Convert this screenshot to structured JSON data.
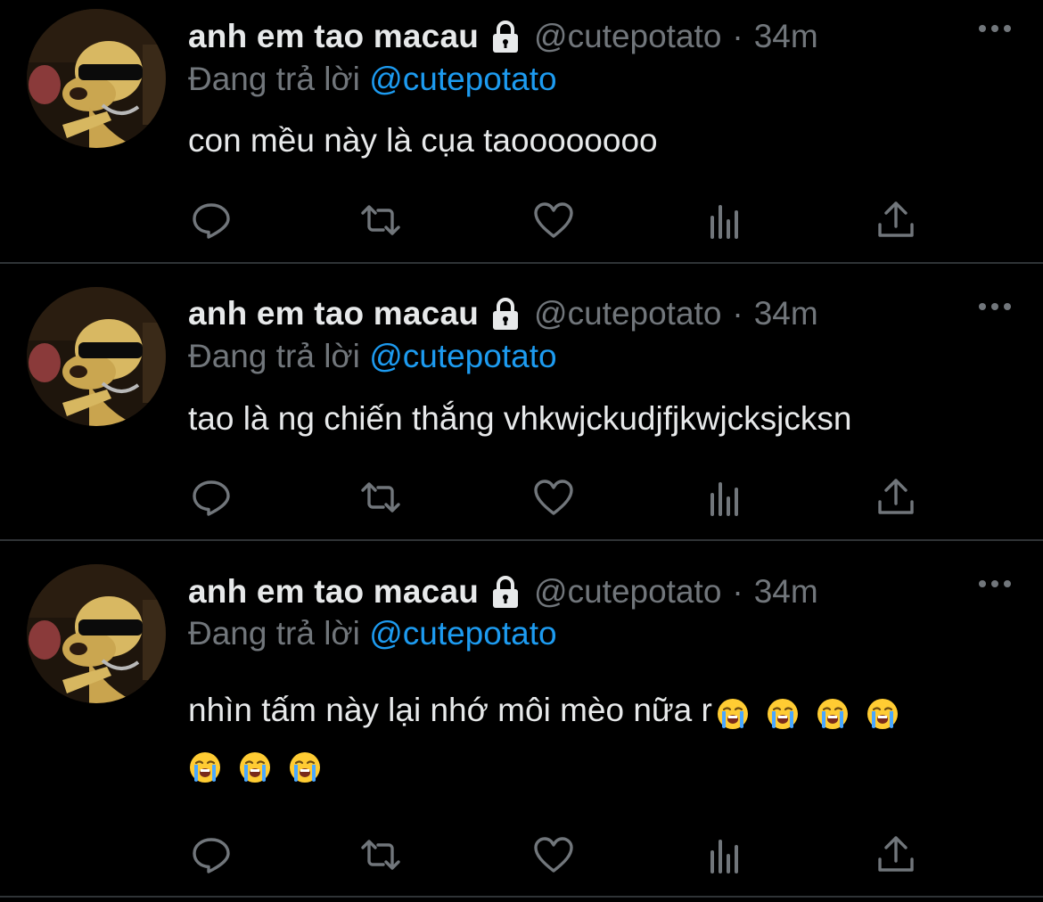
{
  "tweets": [
    {
      "name": "anh em tao macau",
      "handle": "@cutepotato",
      "dot": "·",
      "time": "34m",
      "replying_prefix": "Đang trả lời",
      "replying_to": "@cutepotato",
      "text": "con mều này là cụa taoooooooo",
      "emojis": []
    },
    {
      "name": "anh em tao macau",
      "handle": "@cutepotato",
      "dot": "·",
      "time": "34m",
      "replying_prefix": "Đang trả lời",
      "replying_to": "@cutepotato",
      "text": "tao là ng chiến thắng vhkwjckudjfjkwjcksjcksn",
      "emojis": []
    },
    {
      "name": "anh em tao macau",
      "handle": "@cutepotato",
      "dot": "·",
      "time": "34m",
      "replying_prefix": "Đang trả lời",
      "replying_to": "@cutepotato",
      "text": "nhìn tấm này lại nhớ môi mèo nữa r",
      "emojis": [
        "loudly-crying-face",
        "loudly-crying-face",
        "loudly-crying-face",
        "loudly-crying-face",
        "loudly-crying-face",
        "loudly-crying-face",
        "loudly-crying-face"
      ]
    }
  ],
  "icons": {
    "lock": "lock-icon",
    "more": "more-icon",
    "reply": "reply-icon",
    "retweet": "retweet-icon",
    "like": "heart-icon",
    "views": "analytics-icon",
    "share": "share-icon"
  },
  "colors": {
    "background": "#000000",
    "text": "#e7e9ea",
    "secondary": "#71767b",
    "accent": "#1d9bf0",
    "divider": "#2f3336"
  }
}
